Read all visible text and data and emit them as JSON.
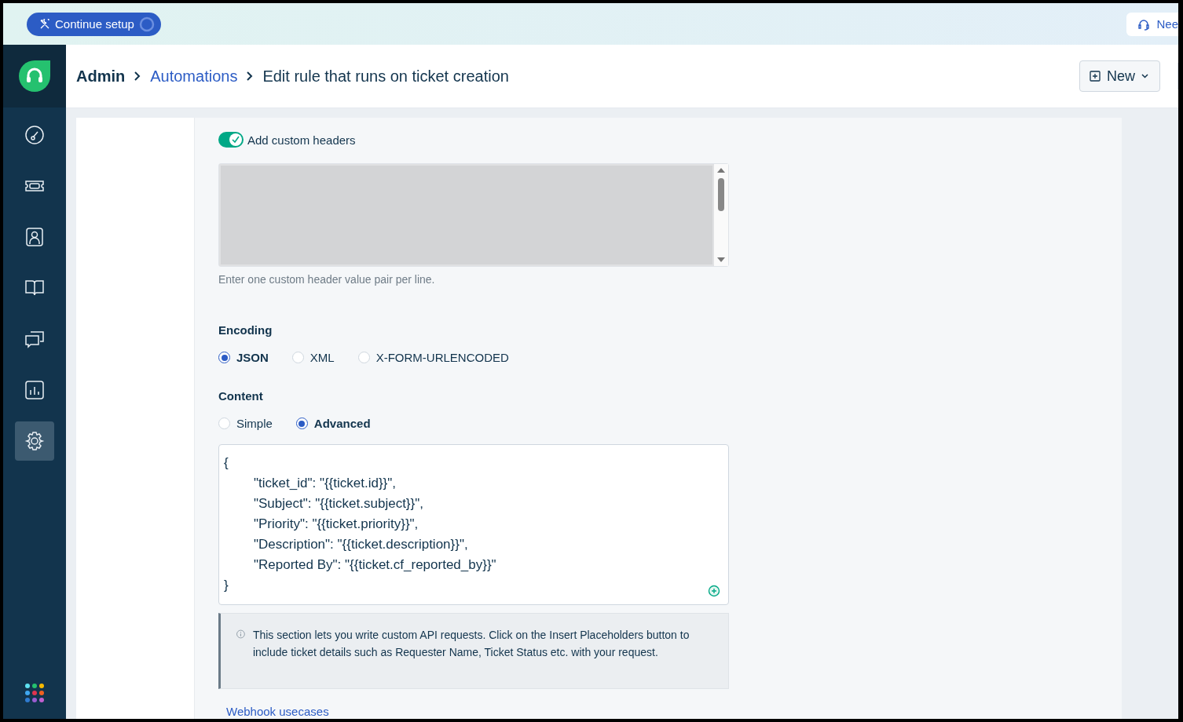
{
  "top_banner": {
    "setup_button": "Continue setup",
    "help_button": "Nee"
  },
  "breadcrumb": [
    {
      "label": "Admin",
      "kind": "root"
    },
    {
      "label": "Automations",
      "kind": "link"
    },
    {
      "label": "Edit rule that runs on ticket creation",
      "kind": "current"
    }
  ],
  "new_button": "New",
  "sidebar": {
    "items": [
      {
        "selected": false
      },
      {
        "selected": false
      },
      {
        "selected": false
      },
      {
        "selected": false
      },
      {
        "selected": false
      },
      {
        "selected": false
      },
      {
        "selected": true
      }
    ]
  },
  "custom_headers": {
    "label": "Add custom headers",
    "on": true,
    "hint": "Enter one custom header value pair per line."
  },
  "encoding": {
    "label": "Encoding",
    "options": [
      {
        "label": "JSON",
        "selected": true
      },
      {
        "label": "XML",
        "selected": false
      },
      {
        "label": "X-FORM-URLENCODED",
        "selected": false
      }
    ]
  },
  "content": {
    "label": "Content",
    "options": [
      {
        "label": "Simple",
        "selected": false
      },
      {
        "label": "Advanced",
        "selected": true
      }
    ],
    "code_lines": [
      {
        "kind": "brace",
        "text": "{"
      },
      {
        "kind": "entry",
        "text": "\"ticket_id\": \"{{ticket.id}}\","
      },
      {
        "kind": "entry",
        "text": "\"Subject\": \"{{ticket.subject}}\","
      },
      {
        "kind": "entry",
        "text": "\"Priority\": \"{{ticket.priority}}\","
      },
      {
        "kind": "entry",
        "text": "\"Description\": \"{{ticket.description}}\","
      },
      {
        "kind": "entry",
        "text": "\"Reported By\": \"{{ticket.cf_reported_by}}\""
      },
      {
        "kind": "brace",
        "text": "}"
      }
    ]
  },
  "info_note": "This section lets you write custom API requests. Click on the Insert Placeholders button to include ticket details such as Requester Name, Ticket Status etc. with your request.",
  "usecases_link": "Webhook usecases"
}
